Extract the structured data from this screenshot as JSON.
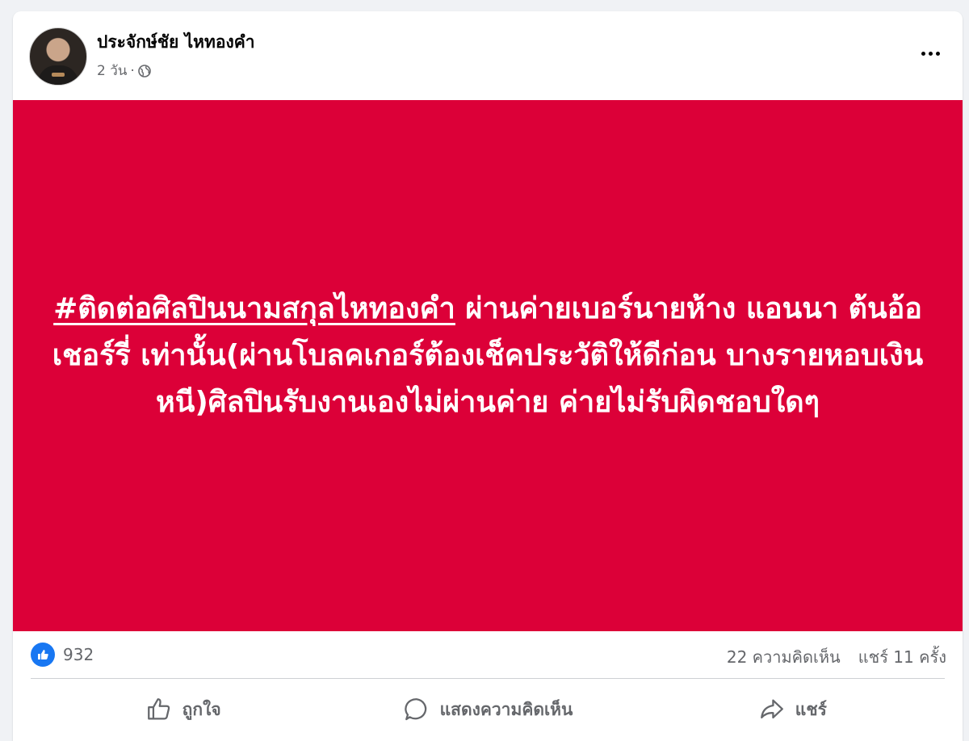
{
  "post": {
    "author": "ประจักษ์ชัย ไหทองคำ",
    "time": "2 วัน",
    "separator": "·",
    "privacy_icon": "globe-icon",
    "more_icon": "more-options-icon"
  },
  "banner": {
    "background": "#dc0038",
    "hashtag": "#ติดต่อศิลปินนามสกุลไหทองคำ",
    "text": " ผ่านค่ายเบอร์นายห้าง แอนนา ต้นอ้อ เชอร์รี่ เท่านั้น(ผ่านโบลคเกอร์ต้องเช็คประวัติให้ดีก่อน บางรายหอบเงินหนี)ศิลปินรับงานเองไม่ผ่านค่าย ค่ายไม่รับผิดชอบใดๆ"
  },
  "stats": {
    "likes": "932",
    "comments": "22 ความคิดเห็น",
    "shares": "แชร์ 11 ครั้ง"
  },
  "actions": {
    "like": "ถูกใจ",
    "comment": "แสดงความคิดเห็น",
    "share": "แชร์"
  },
  "colors": {
    "accent": "#1877f2",
    "secondary_text": "#65676b"
  }
}
